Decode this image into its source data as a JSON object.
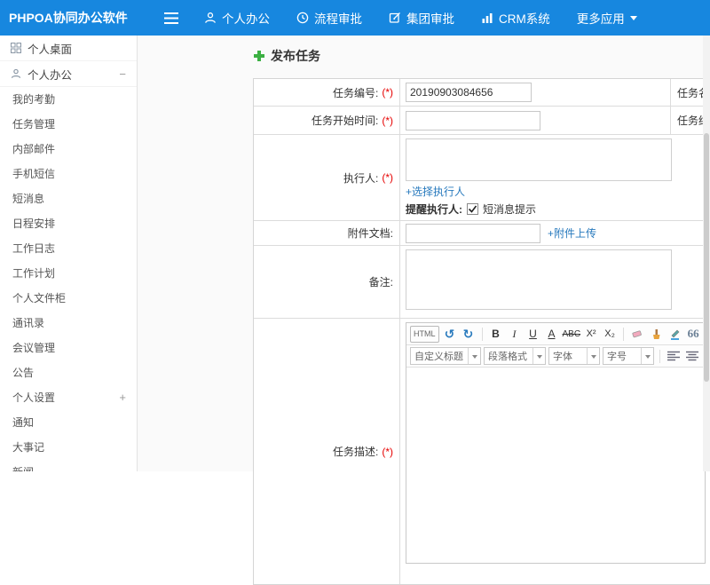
{
  "header": {
    "logo": "PHPOA协同办公软件",
    "nav": [
      "个人办公",
      "流程审批",
      "集团审批",
      "CRM系统",
      "更多应用"
    ]
  },
  "sidebar": {
    "desktop_label": "个人桌面",
    "office_label": "个人办公",
    "collapse_indicator": "−",
    "expand_indicator": "+",
    "items": [
      "我的考勤",
      "任务管理",
      "内部邮件",
      "手机短信",
      "短消息",
      "日程安排",
      "工作日志",
      "工作计划",
      "个人文件柜",
      "通讯录",
      "会议管理",
      "公告"
    ],
    "settings_label": "个人设置",
    "tail_items": [
      "通知",
      "大事记",
      "新闻"
    ]
  },
  "page": {
    "title": "发布任务"
  },
  "form": {
    "required": "(*)",
    "task_no_label": "任务编号:",
    "task_no_value": "20190903084656",
    "task_name_label": "任务名称:",
    "start_label": "任务开始时间:",
    "end_label": "任务结束时间:",
    "executor_label": "执行人:",
    "choose_executor": "+选择执行人",
    "remind_label": "提醒执行人:",
    "sms_label": "短消息提示",
    "attach_label": "附件文档:",
    "attach_upload": "+附件上传",
    "remark_label": "备注:",
    "desc_label": "任务描述:"
  },
  "editor": {
    "html": "HTML",
    "undo": "↺",
    "redo": "↻",
    "bold": "B",
    "italic": "I",
    "underline": "U",
    "fontA": "A",
    "strike": "ABC",
    "sup": "X²",
    "sub": "X₂",
    "quote": "66",
    "color": "A",
    "selects": [
      "自定义标题",
      "段落格式",
      "字体",
      "字号"
    ]
  },
  "colors": {
    "header_blue": "#1787df",
    "link_blue": "#2779bd",
    "required_red": "#e60000",
    "plus_green": "#3cb043"
  }
}
